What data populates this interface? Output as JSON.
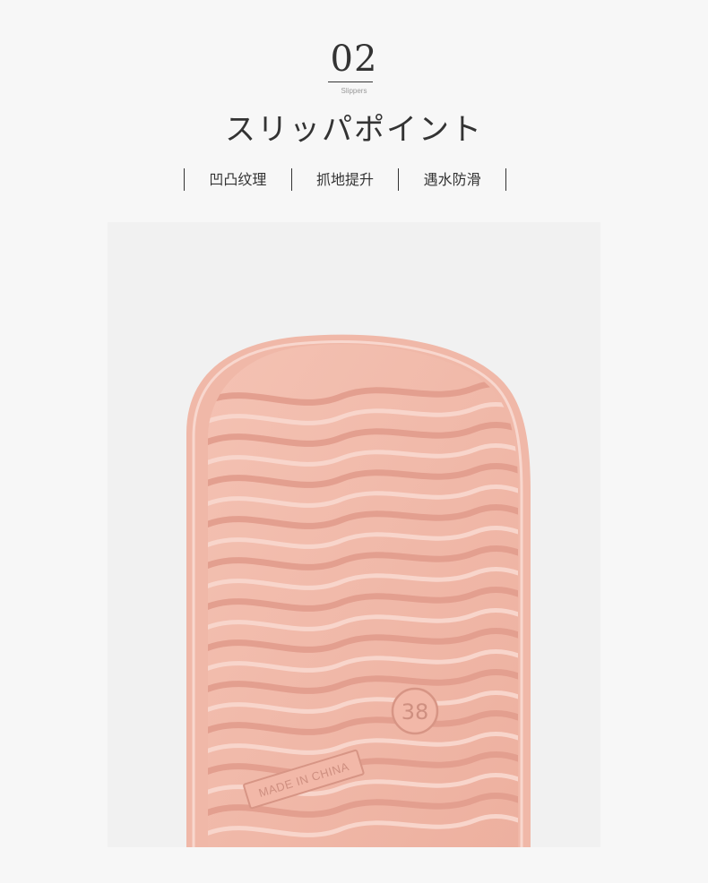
{
  "header": {
    "number": "02",
    "subtitle": "Slippers",
    "title": "スリッパポイント"
  },
  "features": [
    {
      "label": "凹凸纹理"
    },
    {
      "label": "抓地提升"
    },
    {
      "label": "遇水防滑"
    }
  ],
  "product": {
    "size_mark": "38",
    "origin_mark": "MADE IN CHINA",
    "sole_color": "#f2b7a7",
    "background_color": "#f1f1f1"
  }
}
